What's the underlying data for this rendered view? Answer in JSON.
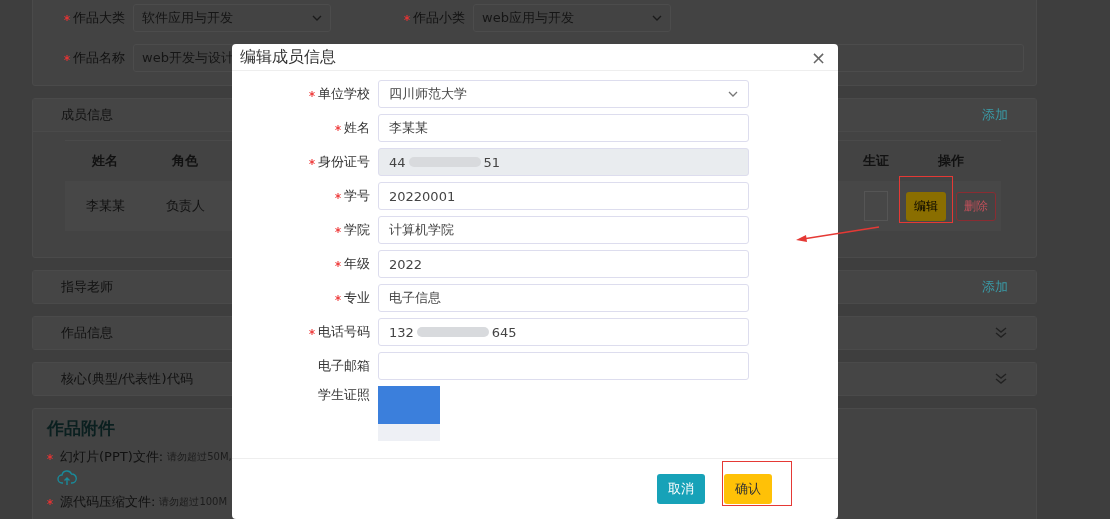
{
  "background_page": {
    "category_row": [
      {
        "label": "作品大类",
        "required": true,
        "value": "软件应用与开发"
      },
      {
        "label": "作品小类",
        "required": true,
        "value": "web应用与开发"
      }
    ],
    "name_field": {
      "label": "作品名称",
      "required": true,
      "value": "web开发与设计"
    },
    "members": {
      "title": "成员信息",
      "action": "添加",
      "columns": [
        "姓名",
        "角色",
        "生证",
        "操作"
      ],
      "rows": [
        {
          "name": "李某某",
          "role": "负责人",
          "buttons": [
            {
              "label": "编辑",
              "kind": "edit"
            },
            {
              "label": "删除",
              "kind": "delete"
            }
          ]
        }
      ]
    },
    "sections": [
      {
        "kind": "addable",
        "title": "指导老师",
        "action": "添加"
      },
      {
        "kind": "collapsible",
        "title": "作品信息",
        "expanded": false
      },
      {
        "kind": "collapsible",
        "title": "核心(典型/代表性)代码",
        "expanded": false
      }
    ],
    "attachments": {
      "title": "作品附件",
      "items": [
        {
          "label": "幻灯片(PPT)文件:",
          "hint": "请勿超过50M,",
          "required": true
        },
        {
          "label": "源代码压缩文件:",
          "hint": "请勿超过100M",
          "required": true
        }
      ]
    }
  },
  "dialog": {
    "title": "编辑成员信息",
    "close": "×",
    "fields": [
      {
        "kind": "select",
        "label": "单位学校",
        "required": true,
        "value": "四川师范大学"
      },
      {
        "kind": "text",
        "label": "姓名",
        "required": true,
        "value": "李某某"
      },
      {
        "kind": "redacted",
        "label": "身份证号",
        "required": true,
        "disabled": true,
        "value_parts": [
          "44",
          "51"
        ]
      },
      {
        "kind": "text",
        "label": "学号",
        "required": true,
        "value": "20220001"
      },
      {
        "kind": "text",
        "label": "学院",
        "required": true,
        "value": "计算机学院"
      },
      {
        "kind": "text",
        "label": "年级",
        "required": true,
        "value": "2022"
      },
      {
        "kind": "text",
        "label": "专业",
        "required": true,
        "value": "电子信息"
      },
      {
        "kind": "redacted",
        "label": "电话号码",
        "required": true,
        "value_parts": [
          "132",
          "645"
        ]
      },
      {
        "kind": "text",
        "label": "电子邮箱",
        "required": false
      },
      {
        "kind": "photo",
        "label": "学生证照",
        "required": false
      }
    ],
    "buttons": [
      {
        "label": "取消",
        "kind": "cancel"
      },
      {
        "label": "确认",
        "kind": "confirm"
      }
    ]
  }
}
